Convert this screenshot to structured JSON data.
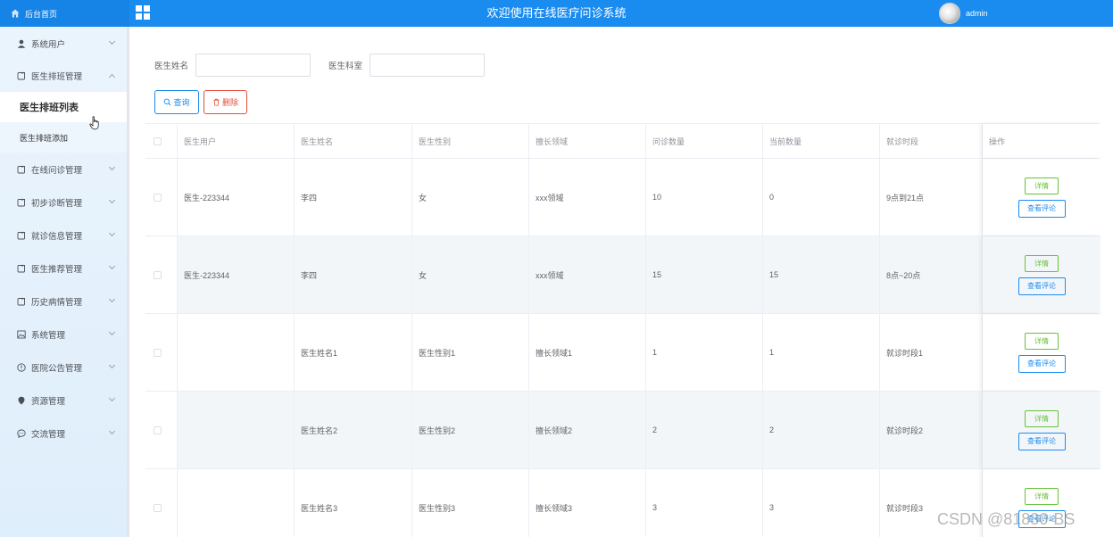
{
  "header": {
    "home_label": "后台首页",
    "app_title": "欢迎使用在线医疗问诊系统",
    "username": "admin",
    "colors": {
      "primary": "#1a8cf0",
      "danger": "#e74c3c",
      "success": "#67c23a"
    }
  },
  "sidebar": {
    "items": [
      {
        "label": "系统用户",
        "icon": "user-icon"
      },
      {
        "label": "医生排班管理",
        "icon": "document-icon",
        "expanded": true,
        "children": [
          {
            "label": "医生排班列表",
            "active": true
          },
          {
            "label": "医生排班添加"
          }
        ]
      },
      {
        "label": "在线问诊管理",
        "icon": "document-icon"
      },
      {
        "label": "初步诊断管理",
        "icon": "document-icon"
      },
      {
        "label": "就诊信息管理",
        "icon": "document-icon"
      },
      {
        "label": "医生推荐管理",
        "icon": "document-icon"
      },
      {
        "label": "历史病情管理",
        "icon": "document-icon"
      },
      {
        "label": "系统管理",
        "icon": "picture-icon"
      },
      {
        "label": "医院公告管理",
        "icon": "info-icon"
      },
      {
        "label": "资源管理",
        "icon": "location-icon"
      },
      {
        "label": "交流管理",
        "icon": "chat-icon"
      }
    ]
  },
  "filters": {
    "doctor_name_label": "医生姓名",
    "doctor_name_value": "",
    "department_label": "医生科室",
    "department_value": "",
    "search_button": "查询",
    "delete_button": "删除"
  },
  "table": {
    "columns": [
      "医生用户",
      "医生姓名",
      "医生性别",
      "擅长领域",
      "问诊数量",
      "当前数量",
      "就诊时段",
      "操作"
    ],
    "rows": [
      {
        "user": "医生-223344",
        "name": "李四",
        "gender": "女",
        "field": "xxx领域",
        "consult_count": "10",
        "current_count": "0",
        "period": "9点到21点"
      },
      {
        "user": "医生-223344",
        "name": "李四",
        "gender": "女",
        "field": "xxx领域",
        "consult_count": "15",
        "current_count": "15",
        "period": "8点~20点"
      },
      {
        "user": "",
        "name": "医生姓名1",
        "gender": "医生性别1",
        "field": "擅长领域1",
        "consult_count": "1",
        "current_count": "1",
        "period": "就诊时段1"
      },
      {
        "user": "",
        "name": "医生姓名2",
        "gender": "医生性别2",
        "field": "擅长领域2",
        "consult_count": "2",
        "current_count": "2",
        "period": "就诊时段2"
      },
      {
        "user": "",
        "name": "医生姓名3",
        "gender": "医生性别3",
        "field": "擅长领域3",
        "consult_count": "3",
        "current_count": "3",
        "period": "就诊时段3"
      }
    ],
    "detail_button": "详情",
    "review_button": "查看评论"
  },
  "watermark": "CSDN @81830-BS"
}
